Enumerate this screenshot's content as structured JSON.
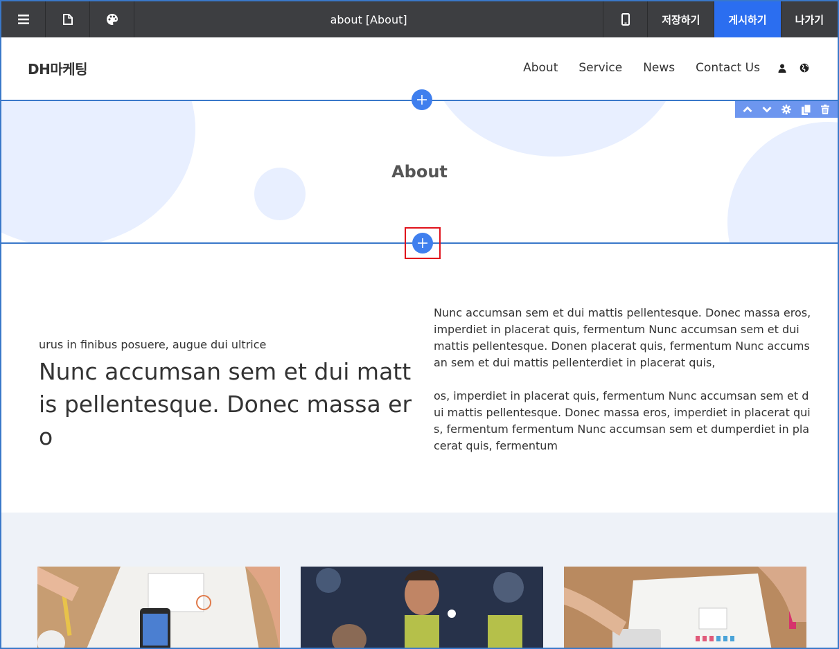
{
  "toolbar": {
    "menu_icon": "menu-icon",
    "page_icon": "page-icon",
    "palette_icon": "palette-icon",
    "title": "about [About]",
    "mobile_icon": "mobile-icon",
    "save_label": "저장하기",
    "publish_label": "게시하기",
    "exit_label": "나가기"
  },
  "header": {
    "logo": "DH마케팅",
    "nav": [
      "About",
      "Service",
      "News",
      "Contact Us"
    ]
  },
  "hero": {
    "title": "About"
  },
  "content": {
    "subtitle": "urus in finibus posuere, augue dui ultrice",
    "headline": "Nunc accumsan sem et dui mattis pellentesque. Donec massa ero",
    "paragraph1": "Nunc accumsan sem et dui mattis pellentesque. Donec massa eros, imperdiet in placerat quis, fermentum Nunc accumsan sem et dui mattis pellentesque. Donen placerat quis, fermentum Nunc accumsan sem et dui mattis pellenterdiet in placerat quis,",
    "paragraph2": " os, imperdiet in placerat quis, fermentum Nunc accumsan sem et dui mattis pellentesque. Donec massa eros, imperdiet in placerat quis, fermentum fermentum Nunc accumsan sem et dumperdiet in placerat quis, fermentum"
  },
  "colors": {
    "toolbar_bg": "#3d3e41",
    "publish_bg": "#2b6ef0",
    "accent": "#3f7fee",
    "selection_border": "#3a78c9",
    "highlight": "#e0121b"
  }
}
